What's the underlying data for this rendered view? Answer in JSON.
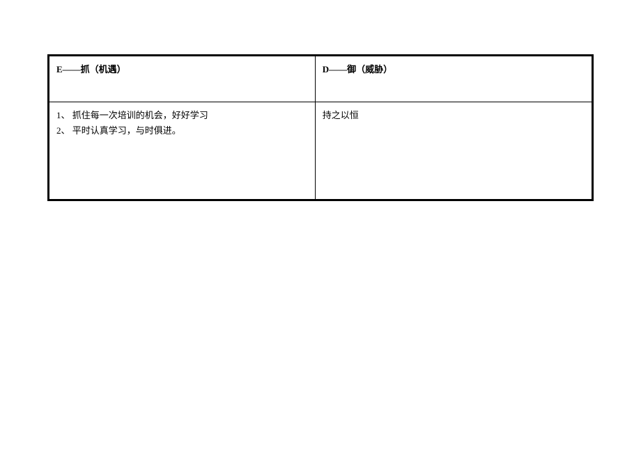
{
  "table": {
    "header_left": "E——抓（机遇）",
    "header_right": "D——御（威胁）",
    "content_left_line1": "1、 抓住每一次培训的机会，好好学习",
    "content_left_line2": "2、 平时认真学习，与时俱进。",
    "content_right": "持之以恒"
  }
}
